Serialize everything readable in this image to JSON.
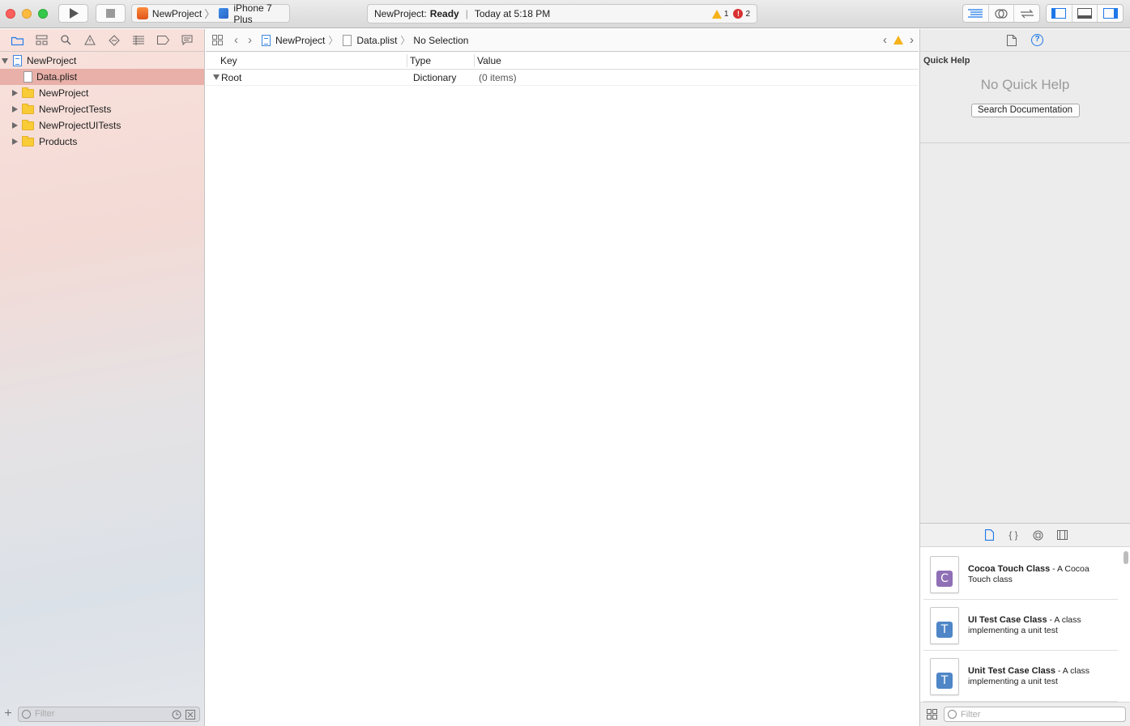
{
  "toolbar": {
    "scheme_name": "NewProject",
    "device_name": "iPhone 7 Plus",
    "activity_project": "NewProject:",
    "activity_status": "Ready",
    "activity_time": "Today at 5:18 PM",
    "warning_count": "1",
    "error_count": "2"
  },
  "navigator": {
    "tree": [
      {
        "label": "NewProject",
        "type": "project",
        "expanded": true
      },
      {
        "label": "Data.plist",
        "type": "file",
        "selected": true
      },
      {
        "label": "NewProject",
        "type": "folder"
      },
      {
        "label": "NewProjectTests",
        "type": "folder"
      },
      {
        "label": "NewProjectUITests",
        "type": "folder"
      },
      {
        "label": "Products",
        "type": "folder"
      }
    ],
    "filter_placeholder": "Filter"
  },
  "editor": {
    "breadcrumb": [
      "NewProject",
      "Data.plist",
      "No Selection"
    ],
    "columns": {
      "key": "Key",
      "type": "Type",
      "value": "Value"
    },
    "rows": [
      {
        "key": "Root",
        "type": "Dictionary",
        "value": "(0 items)"
      }
    ]
  },
  "inspector": {
    "quick_help_title": "Quick Help",
    "no_quick_help": "No Quick Help",
    "search_docs_label": "Search Documentation",
    "library": [
      {
        "badge": "C",
        "badge_color": "#8f6fb5",
        "title": "Cocoa Touch Class",
        "desc": " - A Cocoa Touch class"
      },
      {
        "badge": "T",
        "badge_color": "#4f86c7",
        "title": "UI Test Case Class",
        "desc": " - A class implementing a unit test"
      },
      {
        "badge": "T",
        "badge_color": "#4f86c7",
        "title": "Unit Test Case Class",
        "desc": " - A class implementing a unit test"
      }
    ],
    "filter_placeholder": "Filter"
  },
  "colors": {
    "accent": "#1e78e8",
    "selection": "#e8b0a8",
    "warning": "#f5b21a",
    "error": "#d93030"
  }
}
